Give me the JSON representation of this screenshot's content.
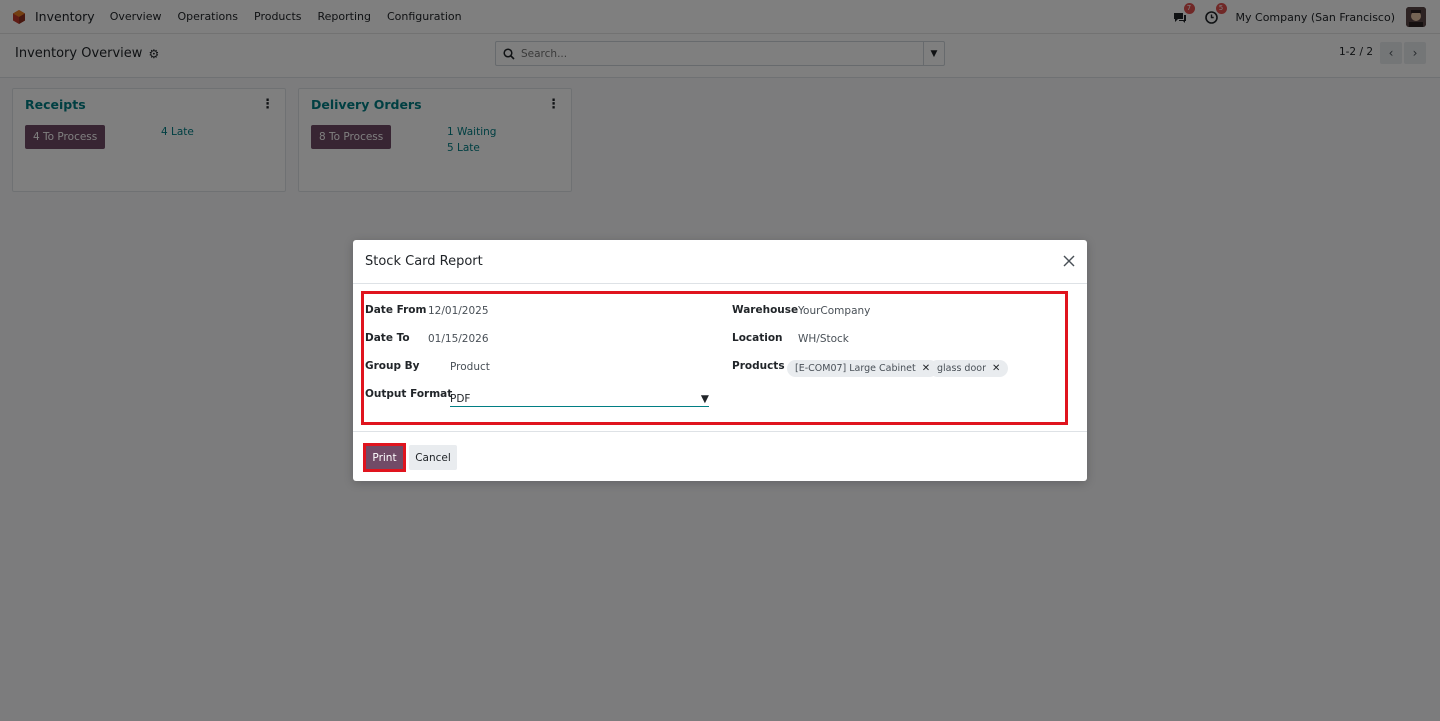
{
  "navbar": {
    "app_name": "Inventory",
    "menu": [
      "Overview",
      "Operations",
      "Products",
      "Reporting",
      "Configuration"
    ],
    "messages_badge": "7",
    "activities_badge": "5",
    "company": "My Company (San Francisco)"
  },
  "control_panel": {
    "breadcrumb": "Inventory Overview",
    "search_placeholder": "Search...",
    "pager": "1-2 / 2"
  },
  "cards": [
    {
      "title": "Receipts",
      "button": "4 To Process",
      "stats": [
        "4 Late"
      ]
    },
    {
      "title": "Delivery Orders",
      "button": "8 To Process",
      "stats": [
        "1 Waiting",
        "5 Late"
      ]
    }
  ],
  "modal": {
    "title": "Stock Card Report",
    "fields": {
      "date_from_label": "Date From",
      "date_from": "12/01/2025",
      "date_to_label": "Date To",
      "date_to": "01/15/2026",
      "group_by_label": "Group By",
      "group_by": "Product",
      "output_format_label": "Output Format",
      "output_format": "PDF",
      "warehouse_label": "Warehouse",
      "warehouse": "YourCompany",
      "location_label": "Location",
      "location": "WH/Stock",
      "products_label": "Products",
      "products": [
        "[E-COM07] Large Cabinet",
        "glass door"
      ]
    },
    "print_label": "Print",
    "cancel_label": "Cancel"
  },
  "colors": {
    "brand": "#714b67",
    "accent": "#017e84",
    "highlight": "#e0141e"
  }
}
